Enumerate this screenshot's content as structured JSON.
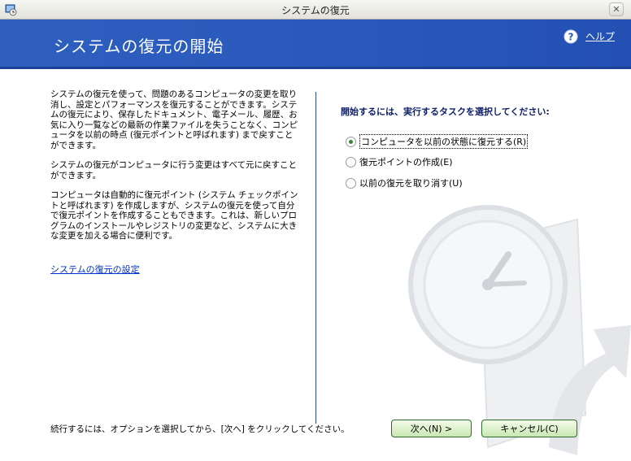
{
  "window": {
    "title": "システムの復元",
    "close_glyph": "✕"
  },
  "header": {
    "title": "システムの復元の開始",
    "help_label": "ヘルプ",
    "help_glyph": "?"
  },
  "left": {
    "paragraphs": [
      "システムの復元を使って、問題のあるコンピュータの変更を取り消し、設定とパフォーマンスを復元することができます。システムの復元により、保存したドキュメント、電子メール、履歴、お気に入り一覧などの最新の作業ファイルを失うことなく、コンピュータを以前の時点 (復元ポイントと呼ばれます) まで戻すことができます。",
      "システムの復元がコンピュータに行う変更はすべて元に戻すことができます。",
      "コンピュータは自動的に復元ポイント (システム チェックポイントと呼ばれます) を作成しますが、システムの復元を使って自分で復元ポイントを作成することもできます。これは、新しいプログラムのインストールやレジストリの変更など、システムに大きな変更を加える場合に便利です。"
    ],
    "settings_link": "システムの復元の設定"
  },
  "right": {
    "heading": "開始するには、実行するタスクを選択してください:",
    "options": [
      {
        "label": "コンピュータを以前の状態に復元する(R)",
        "checked": true
      },
      {
        "label": "復元ポイントの作成(E)",
        "checked": false
      },
      {
        "label": "以前の復元を取り消す(U)",
        "checked": false
      }
    ]
  },
  "footer": {
    "instruction": "続行するには、オプションを選択してから、[次へ] をクリックしてください。",
    "next_button": "次へ(N) >",
    "cancel_button": "キャンセル(C)"
  },
  "colors": {
    "header_blue": "#2a59bb",
    "link_blue": "#0033cc",
    "heading_navy": "#0d1f6a",
    "button_green": "#c9e8b3"
  }
}
